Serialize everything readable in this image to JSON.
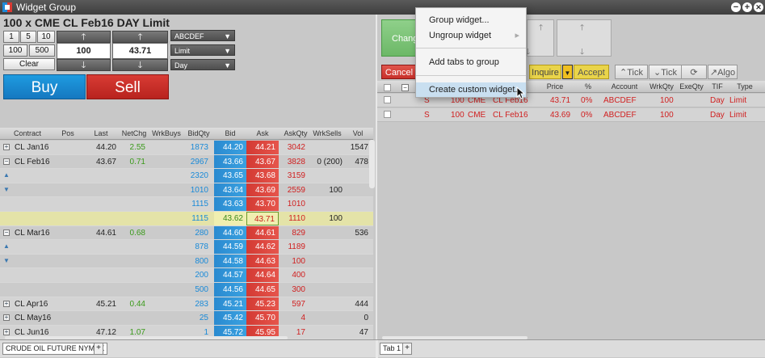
{
  "window": {
    "title": "Widget Group",
    "min": "−",
    "max": "+",
    "close": "✕"
  },
  "order": {
    "title": "100 x CME CL Feb16 DAY Limit",
    "qty_buttons": [
      "1",
      "5",
      "10",
      "100",
      "500"
    ],
    "clear": "Clear",
    "qty_value": "100",
    "price_value": "43.71",
    "account": "ABCDEF",
    "order_type": "Limit",
    "tif": "Day",
    "buy": "Buy",
    "sell": "Sell"
  },
  "ladder": {
    "headers": [
      "Contract",
      "Pos",
      "Last",
      "NetChg",
      "WrkBuys",
      "BidQty",
      "Bid",
      "Ask",
      "AskQty",
      "WrkSells",
      "Vol"
    ],
    "rows": [
      {
        "exp": "+",
        "contract": "CL Jan16",
        "last": "44.20",
        "netchg": "2.55",
        "bidqty": "1873",
        "bid": "44.20",
        "ask": "44.21",
        "askqty": "3042",
        "wrksells": "",
        "vol": "1547",
        "style": "c0"
      },
      {
        "exp": "−",
        "contract": "CL Feb16",
        "last": "43.67",
        "netchg": "0.71",
        "bidqty": "2967",
        "bid": "43.66",
        "ask": "43.67",
        "askqty": "3828",
        "wrksells": "0 (200)",
        "vol": "478",
        "style": "c1"
      },
      {
        "exp": "▲",
        "contract": "",
        "last": "",
        "netchg": "",
        "bidqty": "2320",
        "bid": "43.65",
        "ask": "43.68",
        "askqty": "3159",
        "wrksells": "",
        "vol": "",
        "style": "c0"
      },
      {
        "exp": "▼",
        "contract": "",
        "last": "",
        "netchg": "",
        "bidqty": "1010",
        "bid": "43.64",
        "ask": "43.69",
        "askqty": "2559",
        "wrksells": "100",
        "vol": "",
        "style": "c1"
      },
      {
        "exp": "",
        "contract": "",
        "last": "",
        "netchg": "",
        "bidqty": "1115",
        "bid": "43.63",
        "ask": "43.70",
        "askqty": "1010",
        "wrksells": "",
        "vol": "",
        "style": "c0"
      },
      {
        "exp": "",
        "contract": "",
        "last": "",
        "netchg": "",
        "bidqty": "1115",
        "bid": "43.62",
        "ask": "43.71",
        "askqty": "1110",
        "wrksells": "100",
        "vol": "",
        "style": "hl"
      },
      {
        "exp": "−",
        "contract": "CL Mar16",
        "last": "44.61",
        "netchg": "0.68",
        "bidqty": "280",
        "bid": "44.60",
        "ask": "44.61",
        "askqty": "829",
        "wrksells": "",
        "vol": "536",
        "style": "c1"
      },
      {
        "exp": "▲",
        "contract": "",
        "last": "",
        "netchg": "",
        "bidqty": "878",
        "bid": "44.59",
        "ask": "44.62",
        "askqty": "1189",
        "wrksells": "",
        "vol": "",
        "style": "c0"
      },
      {
        "exp": "▼",
        "contract": "",
        "last": "",
        "netchg": "",
        "bidqty": "800",
        "bid": "44.58",
        "ask": "44.63",
        "askqty": "100",
        "wrksells": "",
        "vol": "",
        "style": "c1"
      },
      {
        "exp": "",
        "contract": "",
        "last": "",
        "netchg": "",
        "bidqty": "200",
        "bid": "44.57",
        "ask": "44.64",
        "askqty": "400",
        "wrksells": "",
        "vol": "",
        "style": "c0"
      },
      {
        "exp": "",
        "contract": "",
        "last": "",
        "netchg": "",
        "bidqty": "500",
        "bid": "44.56",
        "ask": "44.65",
        "askqty": "300",
        "wrksells": "",
        "vol": "",
        "style": "c1"
      },
      {
        "exp": "+",
        "contract": "CL Apr16",
        "last": "45.21",
        "netchg": "0.44",
        "bidqty": "283",
        "bid": "45.21",
        "ask": "45.23",
        "askqty": "597",
        "wrksells": "",
        "vol": "444",
        "style": "c0"
      },
      {
        "exp": "+",
        "contract": "CL May16",
        "last": "",
        "netchg": "",
        "bidqty": "25",
        "bid": "45.42",
        "ask": "45.70",
        "askqty": "4",
        "wrksells": "",
        "vol": "0",
        "style": "c1"
      },
      {
        "exp": "+",
        "contract": "CL Jun16",
        "last": "47.12",
        "netchg": "1.07",
        "bidqty": "1",
        "bid": "45.72",
        "ask": "45.95",
        "askqty": "17",
        "wrksells": "",
        "vol": "47",
        "style": "c0"
      }
    ]
  },
  "left_tab": "CRUDE OIL FUTURE NYMEX",
  "right_tab": "Tab 1",
  "add_tab": "+",
  "orders_toolbar": {
    "change": "Chang",
    "cancel": "Cancel",
    "inquire": "Inquire",
    "accept": "Accept",
    "tick_up": "Tick",
    "tick_down": "Tick",
    "refresh": "⟳",
    "algo": "Algo"
  },
  "orders": {
    "headers": [
      "Price",
      "%",
      "Account",
      "WrkQty",
      "ExeQty",
      "TIF",
      "Type"
    ],
    "rows": [
      {
        "side": "S",
        "qty": "100",
        "exch": "CME",
        "contract": "CL Feb16",
        "price": "43.71",
        "pct": "0%",
        "account": "ABCDEF",
        "wrkqty": "100",
        "tif": "Day",
        "type": "Limit"
      },
      {
        "side": "S",
        "qty": "100",
        "exch": "CME",
        "contract": "CL Feb16",
        "price": "43.69",
        "pct": "0%",
        "account": "ABCDEF",
        "wrkqty": "100",
        "tif": "Day",
        "type": "Limit"
      }
    ]
  },
  "context_menu": {
    "items": [
      "Group widget...",
      "Ungroup widget",
      "Add tabs to group",
      "Create custom widget..."
    ]
  },
  "colors": {
    "bid": "#2a8ad0",
    "ask": "#d33a33",
    "buy": "#1e9be0",
    "sell": "#d83b34",
    "highlight": "#e4e3a8",
    "menu_hover": "#c9dff0"
  }
}
